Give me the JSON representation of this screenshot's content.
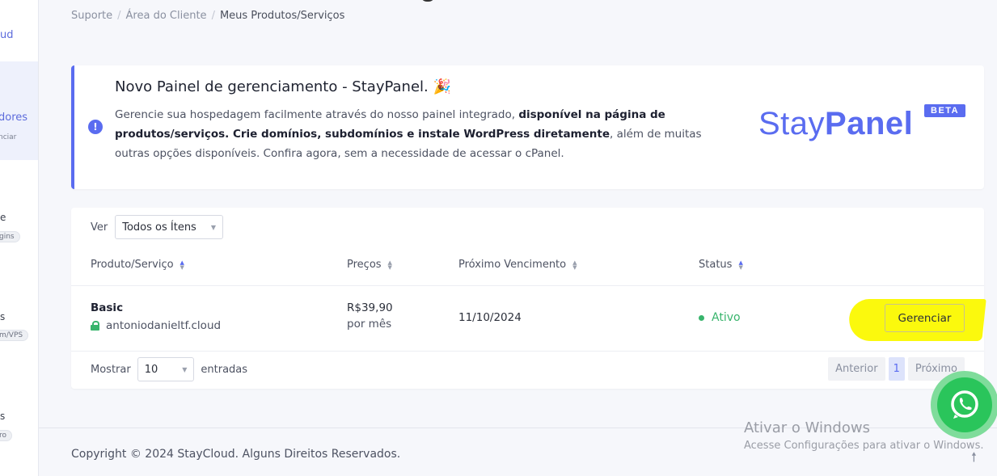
{
  "sidebar": {
    "brand_fragment": "ud",
    "active_item": "dores",
    "active_sub": "nciar",
    "item2": "e",
    "item2_pill": "gins",
    "item3": "s",
    "item3_pill": "m/VPS",
    "item4": "s",
    "item4_pill": "ro"
  },
  "breadcrumb": {
    "items": [
      "Suporte",
      "Área do Cliente",
      "Meus Produtos/Serviços"
    ],
    "separator": "/"
  },
  "notice": {
    "title": "Novo Painel de gerenciamento - StayPanel.",
    "title_emoji": "🎉",
    "icon": "!",
    "body_part1": "Gerencie sua hospedagem facilmente através do nosso painel integrado, ",
    "body_bold": "disponível na página de produtos/serviços. Crie domínios, subdomínios e instale WordPress diretamente",
    "body_part2": ", além de muitas outras opções disponíveis. Confira agora, sem a necessidade de acessar o cPanel.",
    "brand_stay": "Stay",
    "brand_panel": "Panel",
    "badge": "BETA"
  },
  "table": {
    "filter_label": "Ver",
    "filter_value": "Todos os Ítens",
    "columns": [
      "Produto/Serviço",
      "Preços",
      "Próximo Vencimento",
      "Status"
    ],
    "rows": [
      {
        "product": "Basic",
        "domain": "antoniodanieltf.cloud",
        "price": "R$39,90",
        "period": "por mês",
        "due": "11/10/2024",
        "status": "Ativo",
        "action": "Gerenciar"
      }
    ],
    "show_label": "Mostrar",
    "page_size": "10",
    "entries_label": "entradas",
    "pagination": {
      "prev": "Anterior",
      "current": "1",
      "next": "Próximo"
    }
  },
  "footer": {
    "copyright": "Copyright © 2024 StayCloud. Alguns Direitos Reservados."
  },
  "watermark": {
    "line1": "Ativar o Windows",
    "line2": "Acesse Configurações para ativar o Windows."
  },
  "colors": {
    "accent": "#5a6cf0",
    "success": "#38b46c",
    "highlight": "#fbf90d",
    "whatsapp": "#2ac55b"
  },
  "icons": {
    "notice": "exclamation-circle-icon",
    "party": "party-popper-icon",
    "lock": "lock-icon",
    "whatsapp": "whatsapp-icon",
    "scroll_top": "arrow-up-icon"
  }
}
